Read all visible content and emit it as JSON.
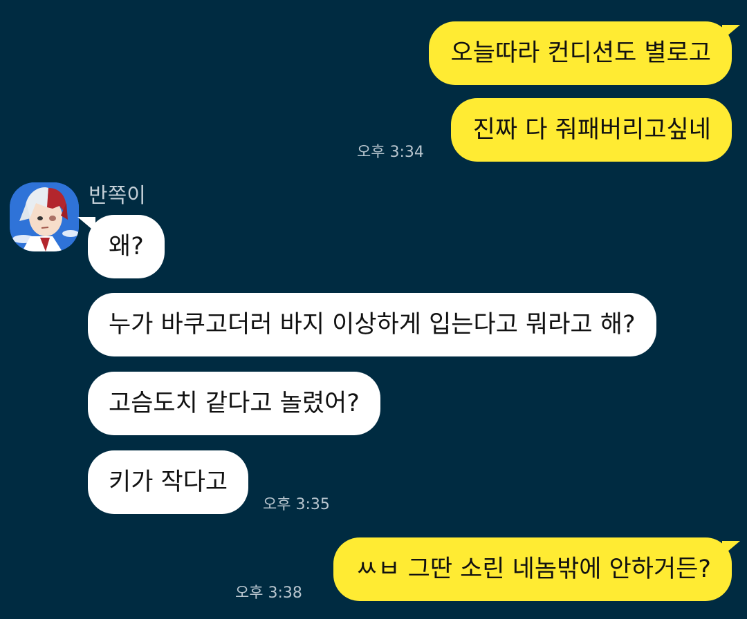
{
  "chat": {
    "sender_name": "반쪽이",
    "messages": [
      {
        "from": "me",
        "text": "오늘따라 컨디션도 별로고"
      },
      {
        "from": "me",
        "text": "진짜 다 줘패버리고싶네",
        "time": "오후 3:34"
      },
      {
        "from": "them",
        "text": "왜?"
      },
      {
        "from": "them",
        "text": "누가 바쿠고더러 바지 이상하게 입는다고 뭐라고 해?"
      },
      {
        "from": "them",
        "text": "고슴도치 같다고 놀렸어?"
      },
      {
        "from": "them",
        "text": "키가 작다고",
        "time": "오후 3:35"
      },
      {
        "from": "me",
        "text": "ㅆㅂ 그딴 소린 네놈밖에 안하거든?",
        "time": "오후 3:38"
      }
    ]
  },
  "colors": {
    "background": "#002b41",
    "my_bubble": "#ffeb33",
    "their_bubble": "#ffffff",
    "timestamp": "#b9c6cf",
    "sender_name": "#c5d0d8"
  },
  "icons": {
    "avatar": "anime-character-avatar-icon"
  }
}
